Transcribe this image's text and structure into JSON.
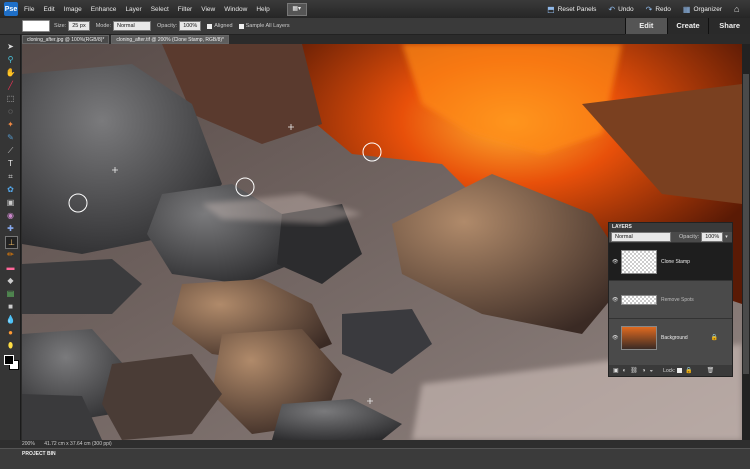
{
  "menubar": {
    "logo": "Pse",
    "items": [
      "File",
      "Edit",
      "Image",
      "Enhance",
      "Layer",
      "Select",
      "Filter",
      "View",
      "Window",
      "Help"
    ],
    "right": [
      {
        "icon": "⬒",
        "label": "Reset Panels"
      },
      {
        "icon": "↶",
        "label": "Undo"
      },
      {
        "icon": "↷",
        "label": "Redo"
      },
      {
        "icon": "▦",
        "label": "Organizer"
      }
    ],
    "home": "⌂"
  },
  "options": {
    "size_label": "Size:",
    "size_value": "25 px",
    "mode_label": "Mode:",
    "mode_value": "Normal",
    "opacity_label": "Opacity:",
    "opacity_value": "100%",
    "aligned": "Aligned",
    "sample_all": "Sample All Layers"
  },
  "panel_tabs": [
    "Edit",
    "Create",
    "Share"
  ],
  "doc_tabs": [
    "cloning_after.jpg @ 100%(RGB/8)*",
    "cloning_after.tif @ 200% (Clone Stamp, RGB/8)*"
  ],
  "status": {
    "zoom": "200%",
    "info": "41.72 cm x 37.64 cm (300 ppi)"
  },
  "project_bin": "PROJECT BIN",
  "layers": {
    "title": "LAYERS",
    "blend": "Normal",
    "opacity_label": "Opacity:",
    "opacity": "100%",
    "rows": [
      {
        "name": "Clone Stamp",
        "selected": true
      },
      {
        "name": "Remove Spots",
        "selected": false
      },
      {
        "name": "Background",
        "selected": false
      }
    ],
    "locks": "Lock:"
  }
}
